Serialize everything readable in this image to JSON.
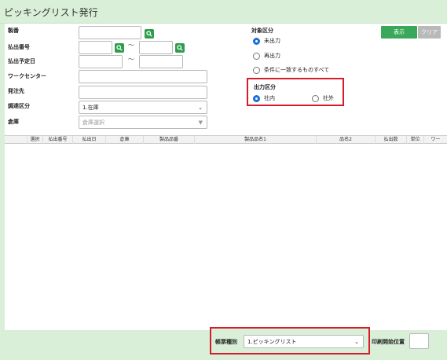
{
  "title": "ピッキングリスト発行",
  "form": {
    "seiban_label": "製番",
    "haraidashi_no_label": "払出番号",
    "haraidashi_yotei_label": "払出予定日",
    "workcenter_label": "ワークセンター",
    "hacchusaki_label": "発注先",
    "chotatsu_label": "調達区分",
    "chotatsu_value": "1.在庫",
    "soko_label": "倉庫",
    "soko_placeholder": "倉庫選択",
    "tilde": "〜"
  },
  "taisho": {
    "label": "対象区分",
    "options": [
      "未出力",
      "再出力",
      "条件に一致するものすべて"
    ],
    "selected_index": 0
  },
  "shutsuryoku": {
    "label": "出力区分",
    "options": [
      "社内",
      "社外"
    ],
    "selected_index": 0
  },
  "buttons": {
    "show": "表示",
    "clear": "クリア"
  },
  "colors": {
    "accent_green": "#2e9e4d",
    "header_bg": "#d9efd7",
    "highlight_red": "#d61c2a",
    "radio_blue": "#1a6fd8"
  },
  "grid": {
    "columns": [
      "選択",
      "払出番号",
      "払出日",
      "倉庫",
      "製品品番",
      "製品品名1",
      "品名2",
      "払出数",
      "単位",
      "ワー"
    ]
  },
  "footer": {
    "chohyo_label": "帳票種別",
    "chohyo_value": "1.ピッキングリスト",
    "insatsu_label": "印刷開始位置",
    "insatsu_value": ""
  }
}
